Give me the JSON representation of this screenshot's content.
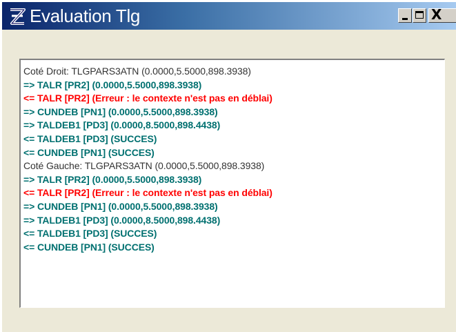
{
  "window": {
    "title": "Evaluation Tlg",
    "app_icon": "app-logo-icon",
    "controls": {
      "minimize": "minimize-icon",
      "maximize": "maximize-icon",
      "close": "close-icon",
      "close_glyph": "X"
    }
  },
  "colors": {
    "header": "#333333",
    "info": "#007070",
    "error": "#ff0000",
    "title_start": "#0a246a",
    "title_end": "#a6caf0",
    "face": "#ece9d8"
  },
  "log": {
    "lines": [
      {
        "text": "Coté Droit: TLGPARS3ATN (0.0000,5.5000,898.3938)",
        "level": "header"
      },
      {
        "text": "=> TALR [PR2] (0.0000,5.5000,898.3938)",
        "level": "call"
      },
      {
        "text": "<= TALR [PR2] (Erreur : le contexte n'est pas en déblai)",
        "level": "error"
      },
      {
        "text": "=> CUNDEB [PN1] (0.0000,5.5000,898.3938)",
        "level": "call"
      },
      {
        "text": "=> TALDEB1 [PD3] (0.0000,8.5000,898.4438)",
        "level": "call"
      },
      {
        "text": "<= TALDEB1 [PD3] (SUCCES)",
        "level": "result"
      },
      {
        "text": "<= CUNDEB [PN1] (SUCCES)",
        "level": "result"
      },
      {
        "text": "Coté Gauche: TLGPARS3ATN (0.0000,5.5000,898.3938)",
        "level": "header"
      },
      {
        "text": "=> TALR [PR2] (0.0000,5.5000,898.3938)",
        "level": "call"
      },
      {
        "text": "<= TALR [PR2] (Erreur : le contexte n'est pas en déblai)",
        "level": "error"
      },
      {
        "text": "=> CUNDEB [PN1] (0.0000,5.5000,898.3938)",
        "level": "call"
      },
      {
        "text": "=> TALDEB1 [PD3] (0.0000,8.5000,898.4438)",
        "level": "call"
      },
      {
        "text": "<= TALDEB1 [PD3] (SUCCES)",
        "level": "result"
      },
      {
        "text": "<= CUNDEB [PN1] (SUCCES)",
        "level": "result"
      }
    ]
  }
}
